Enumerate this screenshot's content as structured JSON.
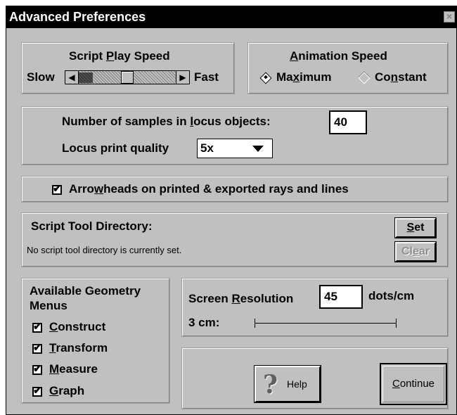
{
  "title": "Advanced Preferences",
  "close_glyph": "×",
  "script_speed": {
    "heading": "Script Play Speed",
    "slow": "Slow",
    "fast": "Fast",
    "level": 0.55
  },
  "animation_speed": {
    "heading": "Animation Speed",
    "maximum": "Maximum",
    "constant": "Constant",
    "selected": "Maximum"
  },
  "locus": {
    "samples_label": "Number of samples in locus objects:",
    "samples_value": "40",
    "quality_label": "Locus print quality",
    "quality_value": "5x"
  },
  "arrowheads": {
    "label": "Arrowheads on printed & exported rays and lines",
    "checked": true
  },
  "script_tool": {
    "heading": "Script Tool Directory:",
    "status": "No script tool directory is currently set.",
    "set": "Set",
    "clear": "Clear"
  },
  "menus": {
    "heading_line1": "Available Geometry",
    "heading_line2": "Menus",
    "items": [
      "Construct",
      "Transform",
      "Measure",
      "Graph"
    ]
  },
  "resolution": {
    "label": "Screen Resolution",
    "value": "45",
    "unit": "dots/cm",
    "ruler_label": "3 cm:"
  },
  "buttons": {
    "help": "Help",
    "continue": "Continue"
  }
}
